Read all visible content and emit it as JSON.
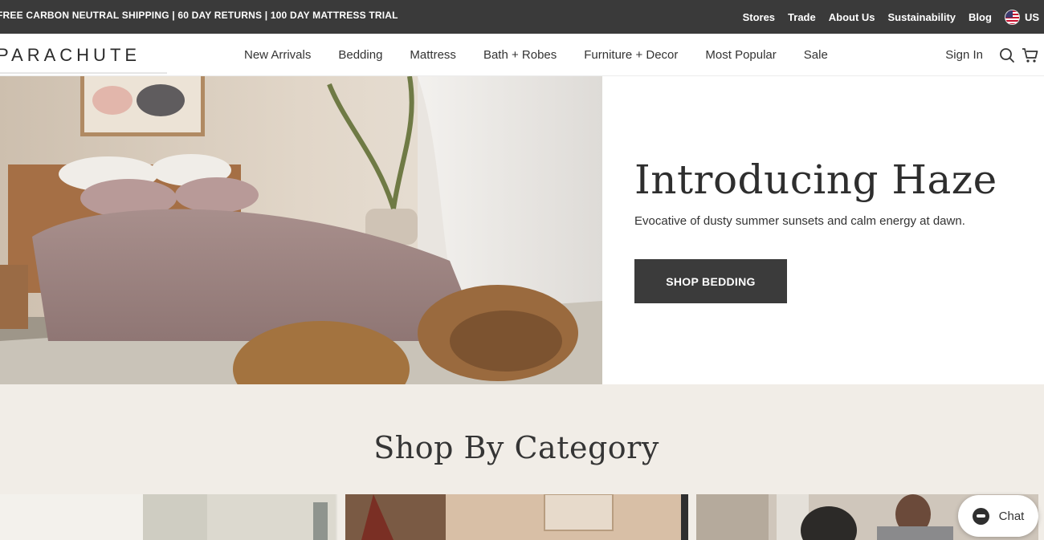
{
  "announcement": {
    "text": "FREE CARBON NEUTRAL SHIPPING | 60 DAY RETURNS | 100 DAY MATTRESS TRIAL"
  },
  "top_links": [
    "Stores",
    "Trade",
    "About Us",
    "Sustainability",
    "Blog"
  ],
  "locale": {
    "label": "US",
    "flag_icon": "us-flag-icon"
  },
  "brand": {
    "logo": "PARACHUTE"
  },
  "nav": {
    "items": [
      "New Arrivals",
      "Bedding",
      "Mattress",
      "Bath + Robes",
      "Furniture + Decor",
      "Most Popular",
      "Sale"
    ],
    "sign_in": "Sign In",
    "search_icon": "search-icon",
    "cart_icon": "cart-icon"
  },
  "hero": {
    "title": "Introducing Haze",
    "subtitle": "Evocative of dusty summer sunsets and calm energy at dawn.",
    "cta": "SHOP BEDDING"
  },
  "category": {
    "title": "Shop By Category"
  },
  "chat": {
    "label": "Chat",
    "icon": "chat-icon"
  },
  "colors": {
    "dark_bar": "#3a3a3a",
    "cta_bg": "#3b3b3b",
    "section_bg": "#f1ede7"
  }
}
